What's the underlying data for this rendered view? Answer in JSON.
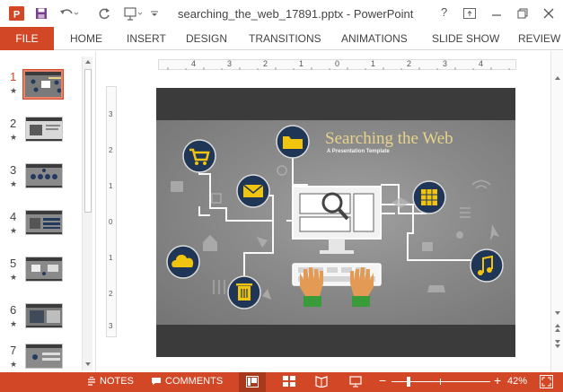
{
  "window": {
    "title": "searching_the_web_17891.pptx - PowerPoint",
    "help_label": "?",
    "accent": "#d24726"
  },
  "ribbon": {
    "file_label": "FILE",
    "tabs": [
      "HOME",
      "INSERT",
      "DESIGN",
      "TRANSITIONS",
      "ANIMATIONS",
      "SLIDE SHOW",
      "REVIEW"
    ]
  },
  "thumbnails": [
    {
      "number": "1",
      "active": true
    },
    {
      "number": "2",
      "active": false
    },
    {
      "number": "3",
      "active": false
    },
    {
      "number": "4",
      "active": false
    },
    {
      "number": "5",
      "active": false
    },
    {
      "number": "6",
      "active": false
    },
    {
      "number": "7",
      "active": false
    }
  ],
  "ruler": {
    "horizontal": [
      "4",
      "3",
      "2",
      "1",
      "0",
      "1",
      "2",
      "3",
      "4"
    ],
    "vertical": [
      "3",
      "2",
      "1",
      "0",
      "1",
      "2",
      "3"
    ]
  },
  "slide": {
    "title": "Searching the Web",
    "subtitle": "A Presentation Template",
    "title_color": "#e7d38a",
    "icons": [
      "shopping-cart-icon",
      "folder-icon",
      "mail-icon",
      "cloud-icon",
      "trash-icon",
      "calculator-icon",
      "music-icon",
      "search-icon",
      "monitor-icon",
      "keyboard-icon",
      "hands-icon"
    ]
  },
  "statusbar": {
    "notes_label": "NOTES",
    "comments_label": "COMMENTS",
    "zoom_minus": "−",
    "zoom_plus": "+",
    "zoom": 42,
    "zoom_label": "42%"
  }
}
